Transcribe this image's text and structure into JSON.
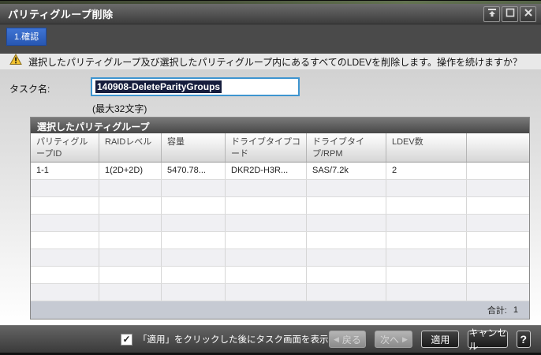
{
  "window": {
    "title": "パリティグループ削除"
  },
  "tab": {
    "label": "1.確認"
  },
  "warning": {
    "message": "選択したパリティグループ及び選択したパリティグループ内にあるすべてのLDEVを削除します。操作を続けますか？"
  },
  "task": {
    "label": "タスク名:",
    "value": "140908-DeleteParityGroups",
    "hint": "(最大32文字)"
  },
  "table": {
    "title": "選択したパリティグループ",
    "columns": [
      "パリティグループID",
      "RAIDレベル",
      "容量",
      "ドライブタイプコード",
      "ドライブタイプ/RPM",
      "LDEV数"
    ],
    "rows": [
      [
        "1-1",
        "1(2D+2D)",
        "5470.78...",
        "DKR2D-H3R...",
        "SAS/7.2k",
        "2"
      ]
    ],
    "empty_row_count": 7,
    "footer": {
      "label": "合計:",
      "value": "1"
    }
  },
  "footer_bar": {
    "checkbox": {
      "checked": true,
      "label": "「適用」をクリックした後にタスク画面を表示"
    },
    "buttons": {
      "back": "戻る",
      "next": "次へ",
      "apply": "適用",
      "cancel": "キャンセル",
      "help": "?"
    }
  },
  "icons": {
    "back_arrow": "◀",
    "next_arrow": "▶",
    "check": "✓"
  },
  "colors": {
    "tab_blue": "#2e62c4",
    "focus_blue": "#3e95d0",
    "warning_yellow": "#f2c230",
    "table_footer_gray": "#c6cad3",
    "selection_navy": "#161d3d"
  }
}
